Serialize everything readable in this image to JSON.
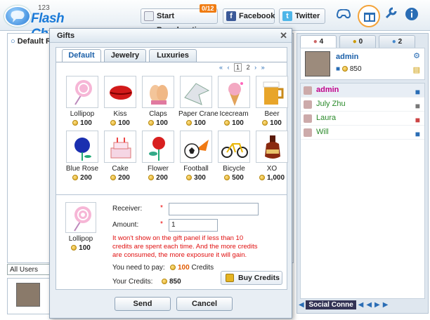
{
  "app": {
    "logo_num": "123",
    "logo_name": "Flash Chat"
  },
  "toolbar": {
    "broadcast_label": "Start Broadcasting",
    "broadcast_badge": "0/12",
    "facebook_label": "Facebook",
    "twitter_label": "Twitter"
  },
  "left": {
    "room_title": "Default R",
    "user_filter": "All Users"
  },
  "right": {
    "tabs": [
      {
        "count": "4"
      },
      {
        "count": "0"
      },
      {
        "count": "2"
      }
    ],
    "self": {
      "name": "admin",
      "credits": "850"
    },
    "users": [
      {
        "name": "admin",
        "color": "#c0008a"
      },
      {
        "name": "July Zhu",
        "color": "#2a8a2a"
      },
      {
        "name": "Laura",
        "color": "#2a8a2a"
      },
      {
        "name": "Will",
        "color": "#2a8a2a"
      }
    ],
    "bottom_label": "Social Conne"
  },
  "dialog": {
    "title": "Gifts",
    "tabs": [
      "Default",
      "Jewelry",
      "Luxuries"
    ],
    "pager": [
      "1",
      "2"
    ],
    "gifts": [
      {
        "name": "Lollipop",
        "price": "100",
        "icon": "lollipop-icon"
      },
      {
        "name": "Kiss",
        "price": "100",
        "icon": "lips-icon"
      },
      {
        "name": "Claps",
        "price": "100",
        "icon": "clap-icon"
      },
      {
        "name": "Paper Crane",
        "price": "100",
        "icon": "crane-icon"
      },
      {
        "name": "Icecream",
        "price": "100",
        "icon": "icecream-icon"
      },
      {
        "name": "Beer",
        "price": "100",
        "icon": "beer-icon"
      },
      {
        "name": "Blue Rose",
        "price": "200",
        "icon": "rose-icon"
      },
      {
        "name": "Cake",
        "price": "200",
        "icon": "cake-icon"
      },
      {
        "name": "Flower",
        "price": "200",
        "icon": "flower-icon"
      },
      {
        "name": "Football",
        "price": "300",
        "icon": "football-icon"
      },
      {
        "name": "Bicycle",
        "price": "500",
        "icon": "bicycle-icon"
      },
      {
        "name": "XO",
        "price": "1,000",
        "icon": "bottle-icon"
      }
    ],
    "selected": {
      "name": "Lollipop",
      "price": "100"
    },
    "receiver_label": "Receiver:",
    "receiver_value": "",
    "amount_label": "Amount:",
    "amount_value": "1",
    "warning": "It won't show on the gift panel if less than 10 credits are spent each time. And the more credits are consumed, the more exposure it will gain.",
    "pay_label": "You need to pay:",
    "pay_value": "100",
    "pay_unit": "Credits",
    "credits_label": "Your Credits:",
    "credits_value": "850",
    "buy_label": "Buy Credits",
    "send_label": "Send",
    "cancel_label": "Cancel"
  },
  "colors": {
    "accent": "#1a7ad8",
    "warning": "#e01010",
    "price_highlight": "#e05a00"
  }
}
